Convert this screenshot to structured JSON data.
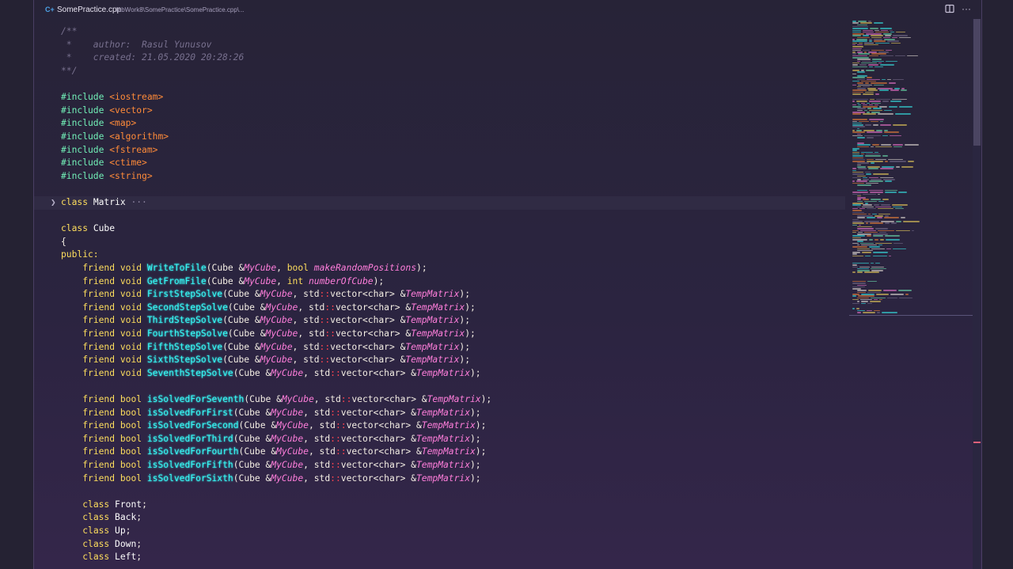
{
  "tab": {
    "icon": "cpp-file-icon",
    "icon_glyph": "C+",
    "filename": "SomePractice.cpp",
    "breadcrumb": "labWork8\\SomePractice\\SomePractice.cpp\\..."
  },
  "actions": {
    "split_icon": "split-editor-icon",
    "more_icon": "more-actions-icon",
    "more_glyph": "···"
  },
  "colors": {
    "comment": "#78708e",
    "preprocessor": "#72f1b8",
    "string": "#ff8b39",
    "keyword": "#fede5d",
    "function": "#36f9f6",
    "parameter": "#ff7edb",
    "namespace": "#fe4450",
    "plain": "#f4eee4"
  },
  "code": {
    "c1": "/**",
    "c2": " *    author:  Rasul Yunusov",
    "c3": " *    created: 21.05.2020 20:28:26",
    "c4": "**/",
    "include_kw": "#include",
    "includes": [
      "<iostream>",
      "<vector>",
      "<map>",
      "<algorithm>",
      "<fstream>",
      "<ctime>",
      "<string>"
    ],
    "fold_glyph": "❯",
    "fold_dots": "···",
    "class_kw": "class",
    "matrix_name": "Matrix",
    "cube_name": "Cube",
    "brace_open": "{",
    "public_kw": "public:",
    "friend_kw": "friend",
    "void_kw": "void",
    "bool_kw": "bool",
    "int_kw": "int",
    "cube_ref": "Cube &",
    "mycube": "MyCube",
    "std_ns": "std",
    "scope": "::",
    "vector_char": "vector<char> &",
    "temp_matrix": "TempMatrix",
    "close": ");",
    "sep": ", ",
    "write_fn": "WriteToFile",
    "write_param": "makeRandomPositions",
    "get_fn": "GetFromFile",
    "get_param": "numberOfCube",
    "void_fns": [
      "FirstStepSolve",
      "SecondStepSolve",
      "ThirdStepSolve",
      "FourthStepSolve",
      "FifthStepSolve",
      "SixthStepSolve",
      "SeventhStepSolve"
    ],
    "bool_fns": [
      "isSolvedForSeventh",
      "isSolvedForFirst",
      "isSolvedForSecond",
      "isSolvedForThird",
      "isSolvedForFourth",
      "isSolvedForFifth",
      "isSolvedForSixth"
    ],
    "nested_classes": [
      "Front",
      "Back",
      "Up",
      "Down",
      "Left"
    ]
  }
}
